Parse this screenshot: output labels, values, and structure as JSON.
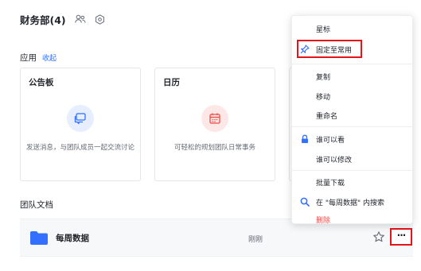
{
  "header": {
    "title": "财务部(4)",
    "icons": [
      "members-icon",
      "settings-icon"
    ]
  },
  "apps": {
    "label": "应用",
    "collapse_label": "收起",
    "cards": [
      {
        "title": "公告板",
        "icon": "message-icon",
        "desc": "发送消息，与团队成员一起交流讨论",
        "accent": "#3370ff"
      },
      {
        "title": "日历",
        "icon": "calendar-icon",
        "desc": "可轻松的规划团队日常事务",
        "accent": "#f54a45"
      }
    ]
  },
  "team_docs": {
    "title": "团队文档",
    "rows": [
      {
        "name": "每周数据",
        "time": "刚刚",
        "icon": "folder-icon"
      }
    ]
  },
  "menu": {
    "items": [
      {
        "label": "星标"
      },
      {
        "label": "固定至常用",
        "icon": "pin-icon"
      },
      {
        "label": "复制"
      },
      {
        "label": "移动"
      },
      {
        "label": "重命名"
      },
      {
        "label": "谁可以看",
        "icon": "lock-icon"
      },
      {
        "label": "谁可以修改"
      },
      {
        "label": "批量下载"
      },
      {
        "label": "在 \"每周数据\" 内搜索",
        "icon": "search-icon"
      },
      {
        "label": "删除",
        "danger": true
      }
    ]
  },
  "colors": {
    "accent": "#3370ff",
    "danger": "#f54a45",
    "highlight_box": "#e3151b"
  }
}
